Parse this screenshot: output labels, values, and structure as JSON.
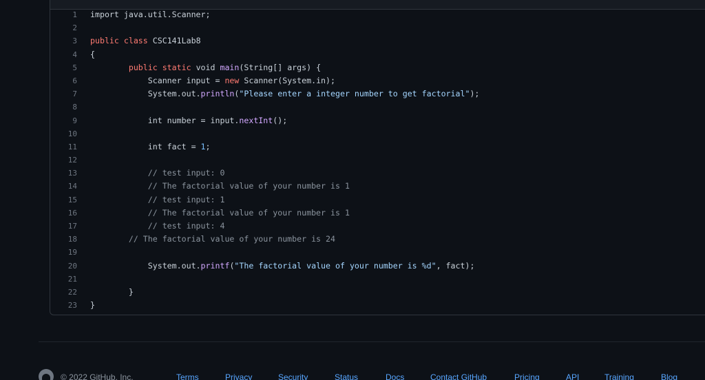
{
  "code": {
    "lines": [
      {
        "n": "1",
        "tokens": [
          {
            "t": "import java.util.Scanner;",
            "c": "plain"
          }
        ]
      },
      {
        "n": "2",
        "tokens": []
      },
      {
        "n": "3",
        "tokens": [
          {
            "t": "public class ",
            "c": "kw"
          },
          {
            "t": "CSC141Lab8",
            "c": "plain"
          }
        ]
      },
      {
        "n": "4",
        "tokens": [
          {
            "t": "{",
            "c": "plain"
          }
        ]
      },
      {
        "n": "5",
        "tokens": [
          {
            "t": "        public static ",
            "c": "kw"
          },
          {
            "t": "void ",
            "c": "plain"
          },
          {
            "t": "main",
            "c": "fn"
          },
          {
            "t": "(String[] args) {",
            "c": "plain"
          }
        ]
      },
      {
        "n": "6",
        "tokens": [
          {
            "t": "            Scanner input = ",
            "c": "plain"
          },
          {
            "t": "new ",
            "c": "kw"
          },
          {
            "t": "Scanner(System.in);",
            "c": "plain"
          }
        ]
      },
      {
        "n": "7",
        "tokens": [
          {
            "t": "            System.out.",
            "c": "plain"
          },
          {
            "t": "println",
            "c": "fn"
          },
          {
            "t": "(",
            "c": "plain"
          },
          {
            "t": "\"Please enter a integer number to get factorial\"",
            "c": "str"
          },
          {
            "t": ");",
            "c": "plain"
          }
        ]
      },
      {
        "n": "8",
        "tokens": []
      },
      {
        "n": "9",
        "tokens": [
          {
            "t": "            int number = input.",
            "c": "plain"
          },
          {
            "t": "nextInt",
            "c": "fn"
          },
          {
            "t": "();",
            "c": "plain"
          }
        ]
      },
      {
        "n": "10",
        "tokens": []
      },
      {
        "n": "11",
        "tokens": [
          {
            "t": "            int fact = ",
            "c": "plain"
          },
          {
            "t": "1",
            "c": "num"
          },
          {
            "t": ";",
            "c": "plain"
          }
        ]
      },
      {
        "n": "12",
        "tokens": []
      },
      {
        "n": "13",
        "tokens": [
          {
            "t": "            // test input: 0",
            "c": "cm"
          }
        ]
      },
      {
        "n": "14",
        "tokens": [
          {
            "t": "            // The factorial value of your number is 1",
            "c": "cm"
          }
        ]
      },
      {
        "n": "15",
        "tokens": [
          {
            "t": "            // test input: 1",
            "c": "cm"
          }
        ]
      },
      {
        "n": "16",
        "tokens": [
          {
            "t": "            // The factorial value of your number is 1",
            "c": "cm"
          }
        ]
      },
      {
        "n": "17",
        "tokens": [
          {
            "t": "            // test input: 4",
            "c": "cm"
          }
        ]
      },
      {
        "n": "18",
        "tokens": [
          {
            "t": "        // The factorial value of your number is 24",
            "c": "cm"
          }
        ]
      },
      {
        "n": "19",
        "tokens": []
      },
      {
        "n": "20",
        "tokens": [
          {
            "t": "            System.out.",
            "c": "plain"
          },
          {
            "t": "printf",
            "c": "fn"
          },
          {
            "t": "(",
            "c": "plain"
          },
          {
            "t": "\"The factorial value of your number is %d\"",
            "c": "str"
          },
          {
            "t": ", fact);",
            "c": "plain"
          }
        ]
      },
      {
        "n": "21",
        "tokens": []
      },
      {
        "n": "22",
        "tokens": [
          {
            "t": "        }",
            "c": "plain"
          }
        ]
      },
      {
        "n": "23",
        "tokens": [
          {
            "t": "}",
            "c": "plain"
          }
        ]
      }
    ]
  },
  "footer": {
    "logo_icon": "github-mark-icon",
    "copyright": "© 2022 GitHub, Inc.",
    "links": {
      "terms": "Terms",
      "privacy": "Privacy",
      "security": "Security",
      "status": "Status",
      "docs": "Docs",
      "contact": "Contact GitHub",
      "pricing": "Pricing",
      "api": "API",
      "training": "Training",
      "blog": "Blog"
    }
  },
  "colors": {
    "background": "#0d1117",
    "keyword": "#ff7b72",
    "function": "#d2a8ff",
    "number": "#79c0ff",
    "string": "#a5d6ff",
    "comment": "#8b949e",
    "link": "#58a6ff"
  }
}
